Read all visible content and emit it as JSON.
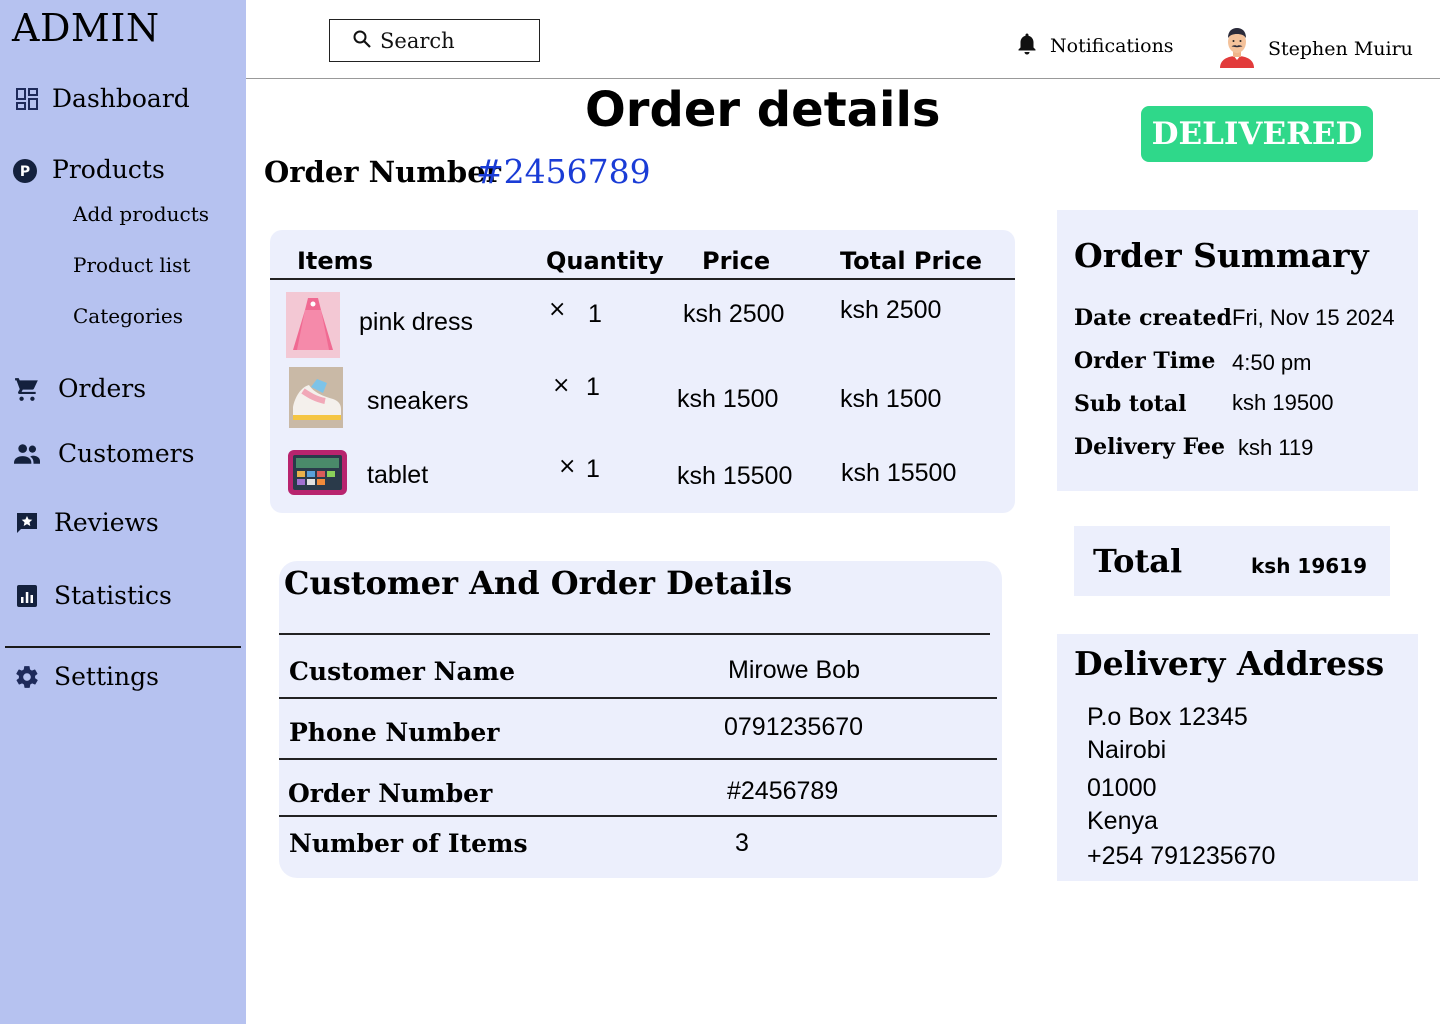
{
  "sidebar": {
    "brand": "ADMIN",
    "items": [
      {
        "label": "Dashboard",
        "icon": "dashboard-icon"
      },
      {
        "label": "Products",
        "icon": "products-icon"
      },
      {
        "label": "Orders",
        "icon": "cart-icon"
      },
      {
        "label": "Customers",
        "icon": "people-icon"
      },
      {
        "label": "Reviews",
        "icon": "reviews-icon"
      },
      {
        "label": "Statistics",
        "icon": "statistics-icon"
      },
      {
        "label": "Settings",
        "icon": "gear-icon"
      }
    ],
    "product_subitems": [
      "Add products",
      "Product list",
      "Categories"
    ]
  },
  "topbar": {
    "search_placeholder": "Search",
    "notifications_label": "Notifications",
    "user_name": "Stephen Muiru"
  },
  "header": {
    "title": "Order details",
    "status": "DELIVERED",
    "status_color": "#2fd88a",
    "order_number_label": "Order Number",
    "order_number": "#2456789"
  },
  "items_table": {
    "columns": [
      "Items",
      "Quantity",
      "Price",
      "Total Price"
    ],
    "rows": [
      {
        "name": "pink dress",
        "qty": "1",
        "price": "ksh 2500",
        "total": "ksh 2500"
      },
      {
        "name": "sneakers",
        "qty": "1",
        "price": "ksh 1500",
        "total": "ksh 1500"
      },
      {
        "name": "tablet",
        "qty": "1",
        "price": "ksh 15500",
        "total": "ksh 15500"
      }
    ],
    "times_symbol": "×"
  },
  "customer_details": {
    "title": "Customer And Order Details",
    "rows": [
      {
        "key": "Customer Name",
        "value": "Mirowe Bob"
      },
      {
        "key": "Phone Number",
        "value": "0791235670"
      },
      {
        "key": "Order Number",
        "value": "#2456789"
      },
      {
        "key": "Number of Items",
        "value": "3"
      }
    ]
  },
  "summary": {
    "title": "Order Summary",
    "rows": [
      {
        "key": "Date created",
        "value": "Fri, Nov 15 2024"
      },
      {
        "key": "Order Time",
        "value": "4:50 pm"
      },
      {
        "key": "Sub total",
        "value": "ksh 19500"
      },
      {
        "key": "Delivery Fee",
        "value": "ksh 119"
      }
    ],
    "total_label": "Total",
    "total_value": "ksh 19619"
  },
  "delivery_address": {
    "title": "Delivery Address",
    "lines": [
      "P.o Box 12345",
      "Nairobi",
      "01000",
      "Kenya",
      "+254 791235670"
    ]
  },
  "colors": {
    "sidebar_bg": "#b6c2f0",
    "card_bg": "#eceffc",
    "accent_blue": "#1a3cd6"
  }
}
